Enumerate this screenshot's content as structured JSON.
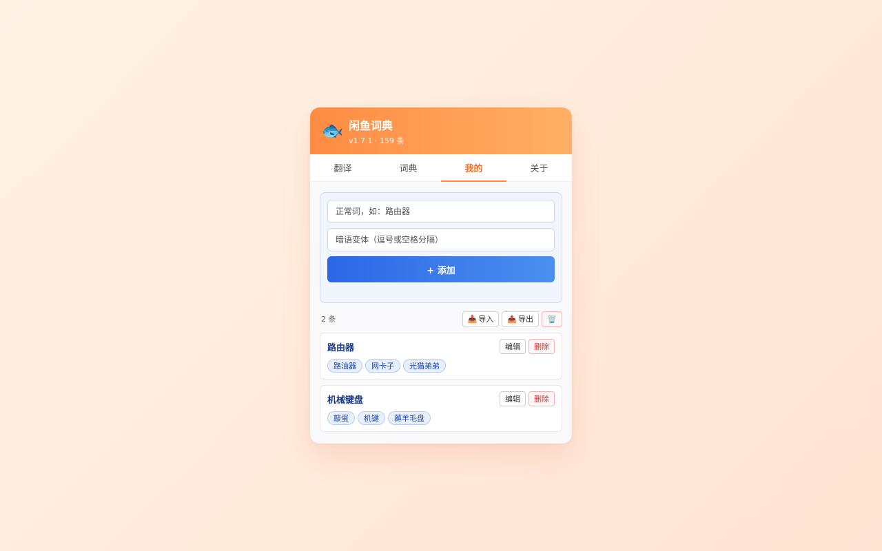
{
  "app": {
    "logo_icon": "🐟",
    "title": "闲鱼词典",
    "subtitle": "v1.7.1 · 159 条",
    "accent": "#ff8c42",
    "primary": "#2b67e6"
  },
  "tabs": [
    {
      "label": "翻译",
      "active": false
    },
    {
      "label": "词典",
      "active": false
    },
    {
      "label": "我的",
      "active": true
    },
    {
      "label": "关于",
      "active": false
    }
  ],
  "form": {
    "word_placeholder": "正常词，如：路由器",
    "variants_placeholder": "暗语变体（逗号或空格分隔）",
    "add_label": "+ 添加"
  },
  "list": {
    "count_label": "2 条",
    "import_icon": "📥",
    "import_label": "导入",
    "export_icon": "📤",
    "export_label": "导出",
    "clear_icon": "🗑️"
  },
  "entries": [
    {
      "word": "路由器",
      "edit_label": "编辑",
      "delete_label": "删除",
      "variants": [
        "路油器",
        "网卡子",
        "光猫弟弟"
      ]
    },
    {
      "word": "机械键盘",
      "edit_label": "编辑",
      "delete_label": "删除",
      "variants": [
        "敲蛋",
        "机键",
        "薅羊毛盘"
      ]
    }
  ]
}
